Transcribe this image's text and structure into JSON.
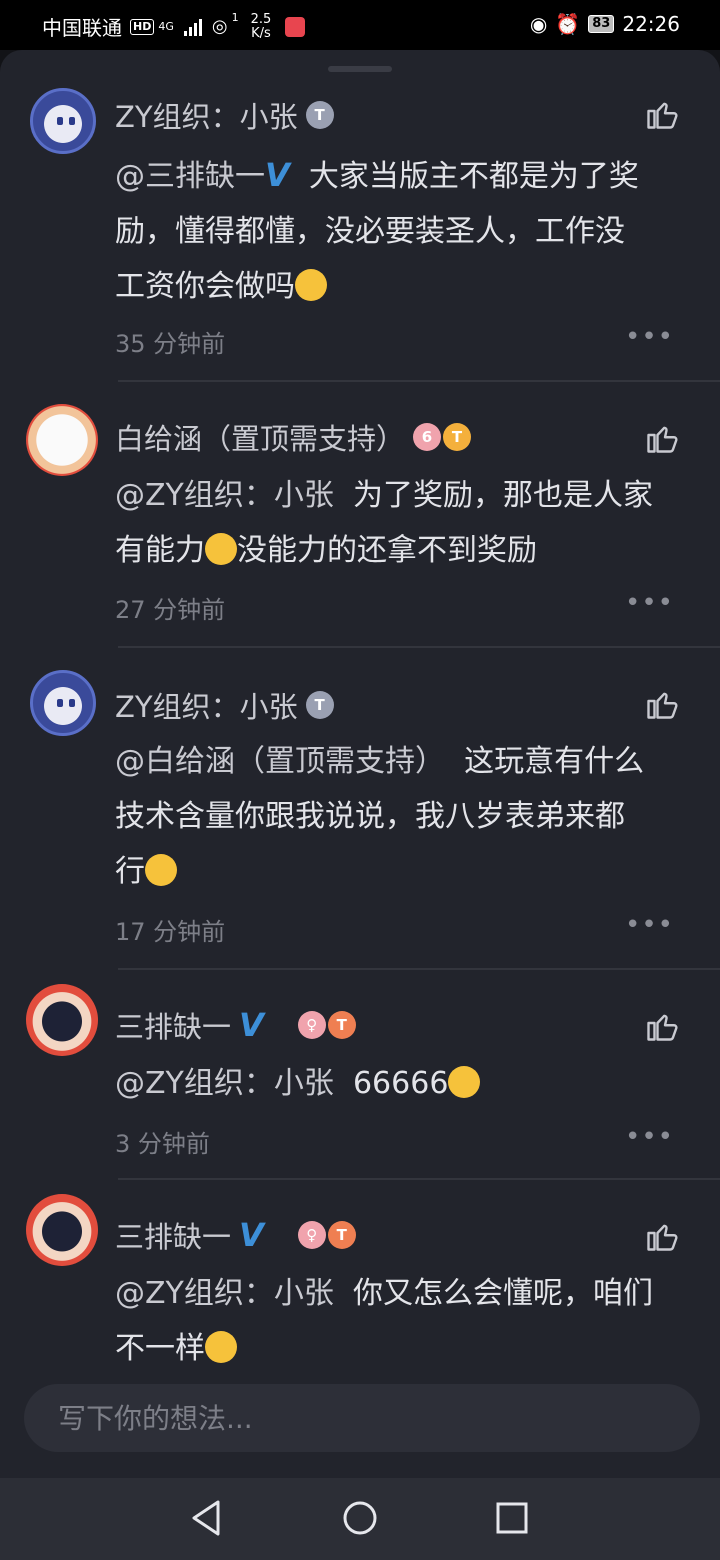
{
  "status_bar": {
    "carrier": "中国联通",
    "hd": "HD",
    "network": "4G",
    "sim_slot": "1",
    "speed_value": "2.5",
    "speed_unit": "K/s",
    "battery": "83",
    "time": "22:26"
  },
  "comments": [
    {
      "name": "ZY组织：小张",
      "badges": [
        {
          "text": "T",
          "color": "#9aa0b2"
        }
      ],
      "verified": false,
      "mention": "@三排缺一",
      "mention_verified": true,
      "lines": [
        "大家当版主不都是为了奖",
        "励，懂得都懂，没必要装圣人，工作没",
        "工资你会做吗"
      ],
      "emoji": "laugh-cry-emoji",
      "time": "35 分钟前"
    },
    {
      "name": "白给涵（置顶需支持）",
      "badges": [
        {
          "text": "6",
          "color": "#f0a3ad"
        },
        {
          "text": "T",
          "color": "#f4b03c"
        }
      ],
      "verified": false,
      "mention": "@ZY组织：小张",
      "lines": [
        "为了奖励，那也是人家",
        "有能力",
        "没能力的还拿不到奖励"
      ],
      "emoji": "tongue-wink-emoji",
      "time": "27 分钟前"
    },
    {
      "name": "ZY组织：小张",
      "badges": [
        {
          "text": "T",
          "color": "#9aa0b2"
        }
      ],
      "verified": false,
      "mention": "@白给涵（置顶需支持）",
      "lines": [
        "这玩意有什么",
        "技术含量你跟我说说，我八岁表弟来都",
        "行"
      ],
      "emoji": "thinking-emoji",
      "time": "17 分钟前"
    },
    {
      "name": "三排缺一",
      "badges": [
        {
          "text": "♀",
          "color": "#f0a3ad"
        },
        {
          "text": "T",
          "color": "#ef7f52"
        }
      ],
      "verified": true,
      "mention": "@ZY组织：小张",
      "lines": [
        "66666"
      ],
      "emoji": "rofl-emoji",
      "time": "3 分钟前"
    },
    {
      "name": "三排缺一",
      "badges": [
        {
          "text": "♀",
          "color": "#f0a3ad"
        },
        {
          "text": "T",
          "color": "#ef7f52"
        }
      ],
      "verified": true,
      "mention": "@ZY组织：小张",
      "lines": [
        "你又怎么会懂呢，咱们",
        "不一样"
      ],
      "emoji": "weary-emoji",
      "time": ""
    }
  ],
  "more_label": "•••",
  "verified_label": "V",
  "input": {
    "placeholder": "写下你的想法..."
  },
  "colors": {
    "accent": "#3d8fd8",
    "background": "#22242c"
  }
}
